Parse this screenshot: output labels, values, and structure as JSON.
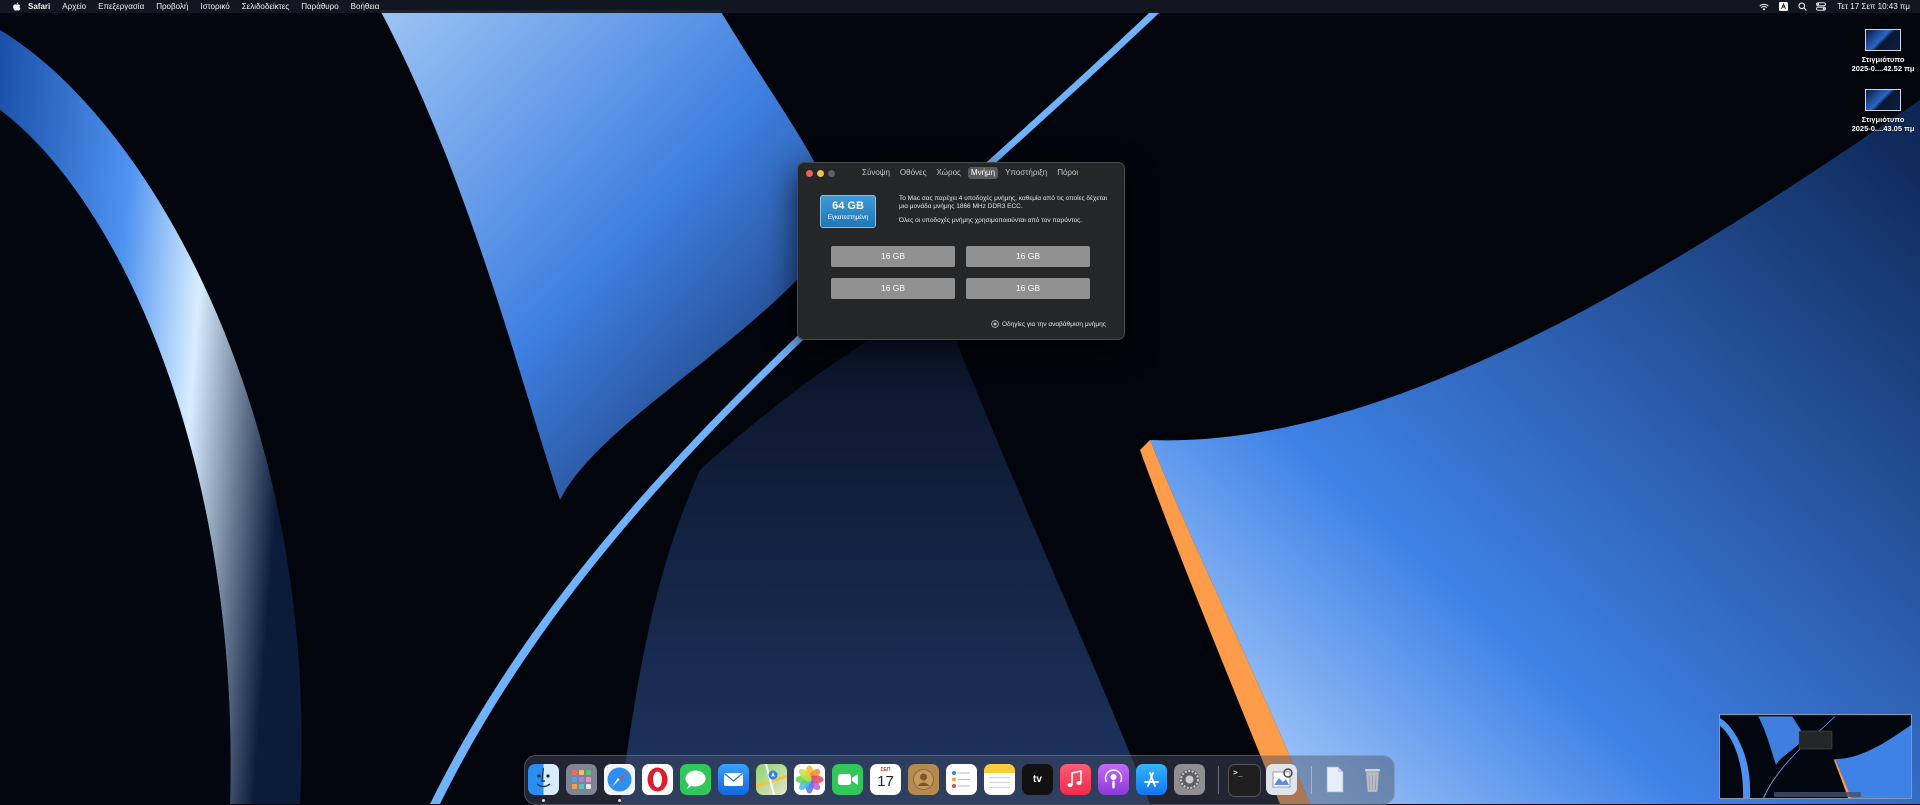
{
  "menubar": {
    "app_name": "Safari",
    "items": [
      "Αρχείο",
      "Επεξεργασία",
      "Προβολή",
      "Ιστορικό",
      "Σελιδοδείκτες",
      "Παράθυρο",
      "Βοήθεια"
    ],
    "clock": "Τετ 17 Σεπ  10:43 πμ",
    "status_icons": [
      "wifi-icon",
      "input-source-icon",
      "spotlight-icon",
      "control-center-icon"
    ]
  },
  "desktop_files": [
    {
      "line1": "Στιγμιότυπο",
      "line2": "2025-0....42.52 πμ"
    },
    {
      "line1": "Στιγμιότυπο",
      "line2": "2025-0....43.05 πμ"
    }
  ],
  "about_window": {
    "tabs": [
      "Σύνοψη",
      "Οθόνες",
      "Χώρος",
      "Μνήμη",
      "Υποστήριξη",
      "Πόροι"
    ],
    "active_tab": "Μνήμη",
    "memory_total": "64 GB",
    "memory_status": "Εγκατεστημένη",
    "description": "Το Mac σας παρέχει 4 υποδοχές μνήμης, καθεμία από τις οποίες δέχεται μια μονάδα μνήμης 1866 MHz DDR3 ECC.",
    "description2": "Όλες οι υποδοχές μνήμης χρησιμοποιούνται από τον παρόντος.",
    "slots": [
      "16 GB",
      "16 GB",
      "16 GB",
      "16 GB"
    ],
    "upgrade_link": "Οδηγίες για την αναβάθμιση μνήμης"
  },
  "dock": {
    "apps": [
      "Finder",
      "Launchpad",
      "Safari",
      "Opera",
      "Messages",
      "Mail",
      "Maps",
      "Photos",
      "FaceTime",
      "Calendar",
      "Contacts",
      "Reminders",
      "Notes",
      "TV",
      "Music",
      "Podcasts",
      "App Store",
      "System Settings",
      "Terminal",
      "Preview",
      "Documents",
      "Trash"
    ],
    "calendar_month": "ΣΕΠ",
    "calendar_day": "17",
    "tv_label": "tv",
    "terminal_prompt": ">_"
  },
  "colors": {
    "accent_blue": "#2a7fc4",
    "slot_gray": "#909090",
    "window_bg": "#252628"
  }
}
